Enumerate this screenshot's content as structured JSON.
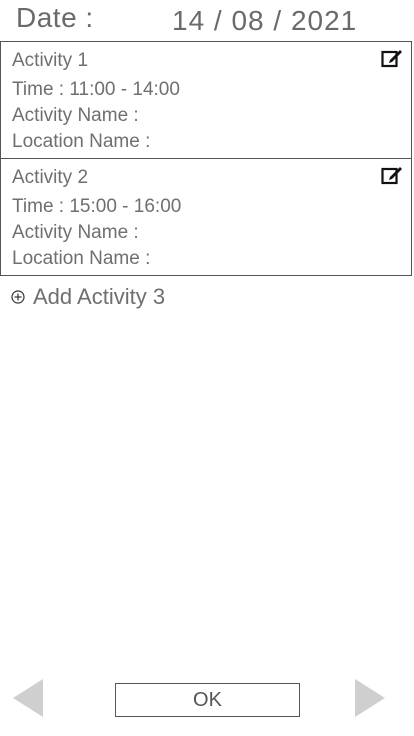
{
  "header": {
    "date_label": "Date :",
    "date_value": "14 / 08 / 2021"
  },
  "activities": [
    {
      "title": "Activity 1",
      "time": "Time : 11:00 - 14:00",
      "activity_name": "Activity Name :",
      "location_name": "Location Name :",
      "edit_icon": "edit-icon"
    },
    {
      "title": "Activity 2",
      "time": "Time : 15:00 - 16:00",
      "activity_name": "Activity Name :",
      "location_name": "Location Name :",
      "edit_icon": "edit-icon"
    }
  ],
  "add_activity": {
    "icon": "circle-plus-icon",
    "label": "Add Activity 3"
  },
  "footer": {
    "prev_icon": "triangle-left-icon",
    "ok_label": "OK",
    "next_icon": "triangle-right-icon"
  },
  "colors": {
    "text": "#6f6f6f",
    "border": "#555555",
    "nav_arrow": "#cfcfcf"
  }
}
